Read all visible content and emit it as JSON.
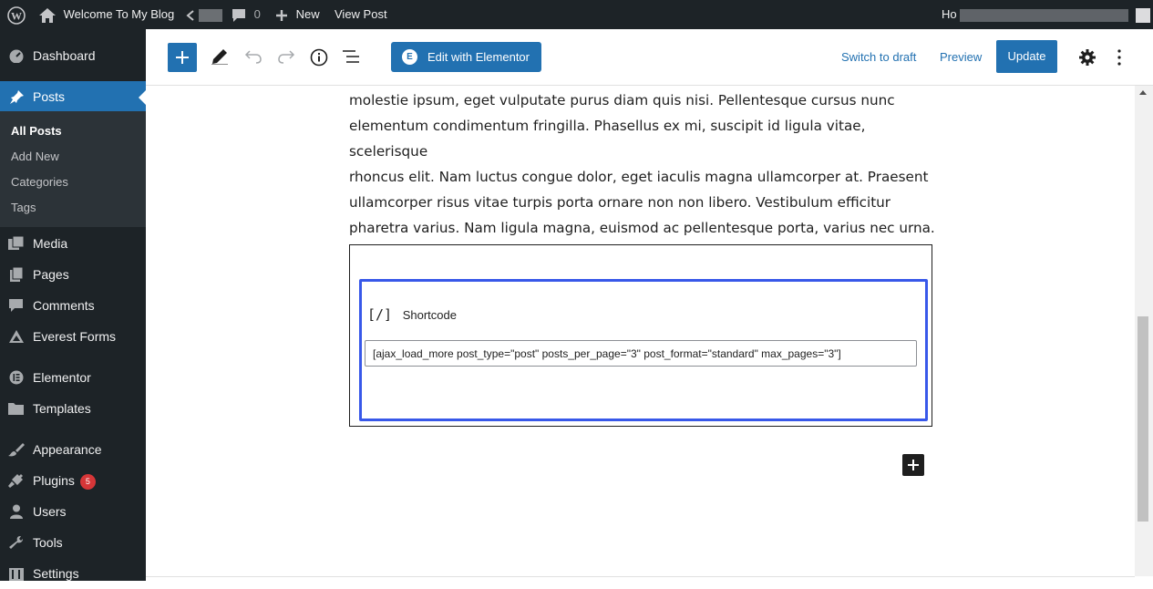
{
  "admin_bar": {
    "site_name": "Welcome To My Blog",
    "comments_count": "0",
    "new_label": "New",
    "view_post_label": "View Post",
    "greeting_prefix": "Ho"
  },
  "sidebar": {
    "items": [
      {
        "label": "Dashboard",
        "icon": "dashboard-icon"
      },
      {
        "label": "Posts",
        "icon": "pin-icon"
      },
      {
        "label": "Media",
        "icon": "media-icon"
      },
      {
        "label": "Pages",
        "icon": "pages-icon"
      },
      {
        "label": "Comments",
        "icon": "comments-icon"
      },
      {
        "label": "Everest Forms",
        "icon": "forms-icon"
      },
      {
        "label": "Elementor",
        "icon": "elementor-icon"
      },
      {
        "label": "Templates",
        "icon": "folder-icon"
      },
      {
        "label": "Appearance",
        "icon": "brush-icon"
      },
      {
        "label": "Plugins",
        "icon": "plug-icon",
        "badge": "5"
      },
      {
        "label": "Users",
        "icon": "user-icon"
      },
      {
        "label": "Tools",
        "icon": "wrench-icon"
      },
      {
        "label": "Settings",
        "icon": "settings-icon"
      }
    ],
    "submenu": [
      "All Posts",
      "Add New",
      "Categories",
      "Tags"
    ]
  },
  "toolbar": {
    "edit_with_elementor": "Edit with Elementor",
    "switch_to_draft": "Switch to draft",
    "preview": "Preview",
    "update": "Update"
  },
  "content": {
    "paragraph_lines": [
      "molestie ipsum, eget vulputate purus diam quis nisi. Pellentesque cursus nunc",
      "elementum condimentum fringilla. Phasellus ex mi, suscipit id ligula vitae, scelerisque",
      "rhoncus elit. Nam luctus congue dolor, eget iaculis magna ullamcorper at. Praesent",
      "ullamcorper risus vitae turpis porta ornare non non libero. Vestibulum efficitur",
      "pharetra varius. Nam ligula magna, euismod ac pellentesque porta, varius nec urna."
    ],
    "shortcode_label": "Shortcode",
    "shortcode_icon_text": "[/]",
    "shortcode_value": "[ajax_load_more post_type=\"post\" posts_per_page=\"3\" post_format=\"standard\" max_pages=\"3\"]"
  },
  "colors": {
    "admin_dark": "#1d2327",
    "accent_blue": "#2271b1",
    "block_focus": "#3858e9",
    "badge_red": "#d63638"
  }
}
